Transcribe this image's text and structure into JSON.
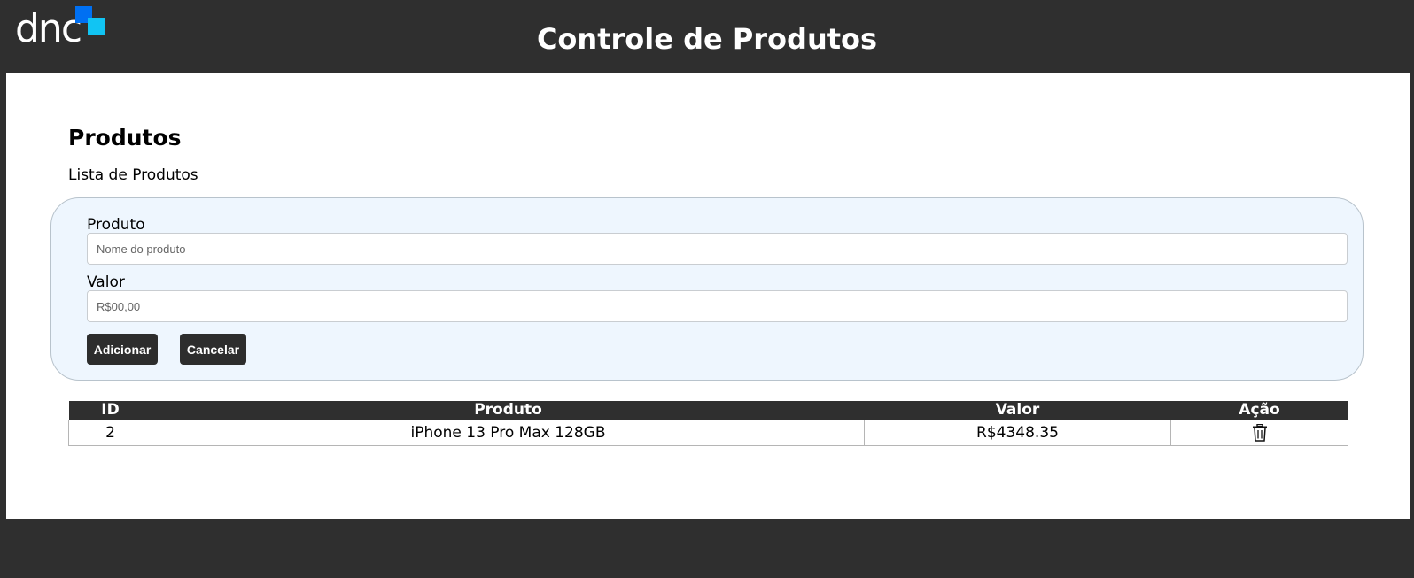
{
  "header": {
    "logo_text": "dnc",
    "title": "Controle de Produtos"
  },
  "page": {
    "title": "Produtos",
    "subtitle": "Lista de Produtos"
  },
  "form": {
    "product_label": "Produto",
    "product_placeholder": "Nome do produto",
    "product_value": "",
    "value_label": "Valor",
    "value_placeholder": "R$00,00",
    "value_value": "",
    "add_button": "Adicionar",
    "cancel_button": "Cancelar"
  },
  "table": {
    "headers": [
      "ID",
      "Produto",
      "Valor",
      "Ação"
    ],
    "rows": [
      {
        "id": "2",
        "product": "iPhone 13 Pro Max 128GB",
        "value": "R$4348.35",
        "action_icon": "trash-icon"
      }
    ]
  },
  "colors": {
    "header_bg": "#2f2f2f",
    "card_bg": "#eef6fe",
    "button_bg": "#2d2d2d",
    "logo_blue": "#0070f2",
    "logo_cyan": "#11c4f3"
  }
}
